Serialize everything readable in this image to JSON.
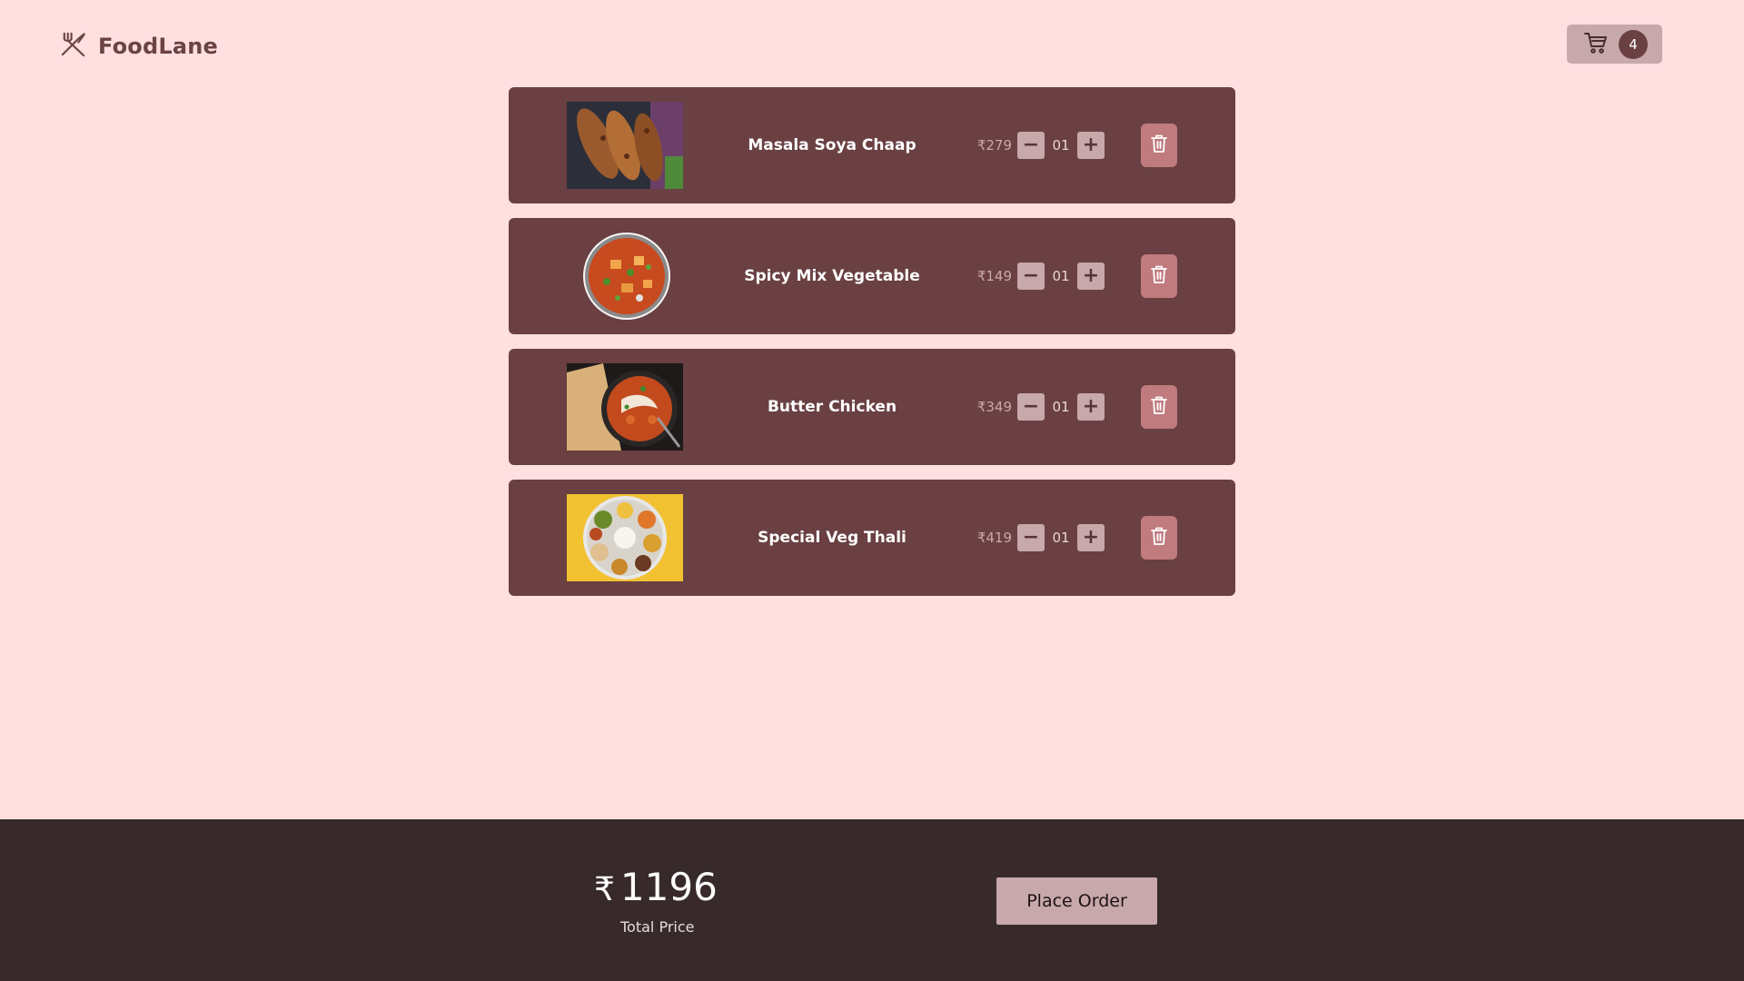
{
  "header": {
    "brand_name": "FoodLane",
    "brand_icon": "utensils-crossed-icon",
    "cart_icon": "shopping-cart-icon",
    "cart_count": "4"
  },
  "cart": {
    "currency_symbol": "₹",
    "items": [
      {
        "name": "Masala Soya Chaap",
        "price": "279",
        "quantity": "01"
      },
      {
        "name": "Spicy Mix Vegetable",
        "price": "149",
        "quantity": "01"
      },
      {
        "name": "Butter Chicken",
        "price": "349",
        "quantity": "01"
      },
      {
        "name": "Special Veg Thali",
        "price": "419",
        "quantity": "01"
      }
    ],
    "decrement_label": "−",
    "increment_label": "+"
  },
  "footer": {
    "currency_symbol": "₹",
    "total_amount": "1196",
    "total_label": "Total Price",
    "place_order_label": "Place Order"
  },
  "colors": {
    "page_background": "#ffdfe0",
    "card_background": "#6a4042",
    "footer_background": "#382a2b",
    "button_background": "#c7a8ab",
    "delete_button": "#c07b7f",
    "brand_text": "#6b4345"
  }
}
